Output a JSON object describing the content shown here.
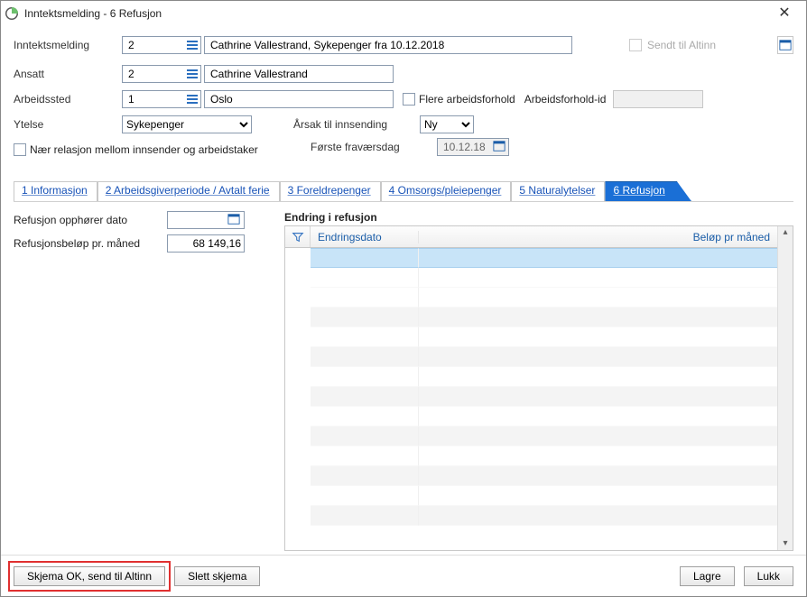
{
  "window": {
    "title": "Inntektsmelding - 6 Refusjon"
  },
  "header": {
    "inntektsmelding_label": "Inntektsmelding",
    "inntektsmelding_num": "2",
    "inntektsmelding_desc": "Cathrine Vallestrand, Sykepenger fra 10.12.2018",
    "sendt_altinn_label": "Sendt til Altinn",
    "ansatt_label": "Ansatt",
    "ansatt_num": "2",
    "ansatt_name": "Cathrine Vallestrand",
    "arbeidssted_label": "Arbeidssted",
    "arbeidssted_num": "1",
    "arbeidssted_name": "Oslo",
    "flere_arbeidsforhold_label": "Flere arbeidsforhold",
    "arbeidsforhold_id_label": "Arbeidsforhold-id",
    "arbeidsforhold_id_value": "",
    "ytelse_label": "Ytelse",
    "ytelse_value": "Sykepenger",
    "aarsak_label": "Årsak til innsending",
    "aarsak_value": "Ny",
    "relasjon_label": "Nær relasjon mellom innsender og arbeidstaker",
    "forste_dag_label": "Første fraværsdag",
    "forste_dag_value": "10.12.18"
  },
  "tabs": [
    {
      "label": "1 Informasjon"
    },
    {
      "label": "2 Arbeidsgiverperiode / Avtalt ferie"
    },
    {
      "label": "3 Foreldrepenger"
    },
    {
      "label": "4 Omsorgs/pleiepenger"
    },
    {
      "label": "5 Naturalytelser"
    }
  ],
  "active_tab": {
    "label": "6 Refusjon"
  },
  "refusjon": {
    "opphorer_label": "Refusjon opphører dato",
    "opphorer_value": "",
    "belop_label": "Refusjonsbeløp pr. måned",
    "belop_value": "68 149,16"
  },
  "grid": {
    "heading": "Endring i refusjon",
    "col1": "Endringsdato",
    "col2": "Beløp pr måned"
  },
  "footer": {
    "send_altinn": "Skjema OK, send til Altinn",
    "slett": "Slett skjema",
    "lagre": "Lagre",
    "lukk": "Lukk"
  }
}
